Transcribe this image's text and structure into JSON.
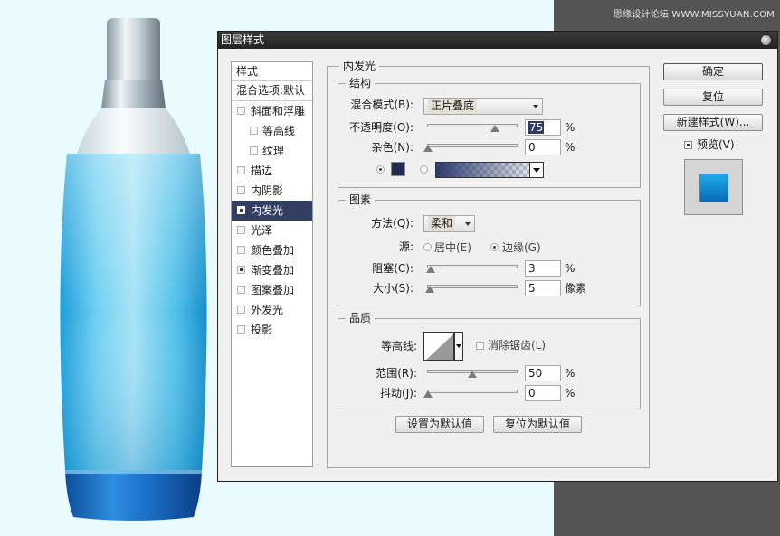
{
  "watermark": "思缘设计论坛 WWW.MISSYUAN.COM",
  "dialog": {
    "title": "图层样式"
  },
  "style_list": {
    "header": "样式",
    "blend_options": "混合选项:默认",
    "items": [
      {
        "label": "斜面和浮雕",
        "checked": false,
        "sub": false
      },
      {
        "label": "等高线",
        "checked": false,
        "sub": true
      },
      {
        "label": "纹理",
        "checked": false,
        "sub": true
      },
      {
        "label": "描边",
        "checked": false,
        "sub": false
      },
      {
        "label": "内阴影",
        "checked": false,
        "sub": false
      },
      {
        "label": "内发光",
        "checked": true,
        "sub": false,
        "selected": true
      },
      {
        "label": "光泽",
        "checked": false,
        "sub": false
      },
      {
        "label": "颜色叠加",
        "checked": false,
        "sub": false
      },
      {
        "label": "渐变叠加",
        "checked": true,
        "sub": false
      },
      {
        "label": "图案叠加",
        "checked": false,
        "sub": false
      },
      {
        "label": "外发光",
        "checked": false,
        "sub": false
      },
      {
        "label": "投影",
        "checked": false,
        "sub": false
      }
    ]
  },
  "inner_glow": {
    "title": "内发光",
    "structure": {
      "title": "结构",
      "blend_mode_label": "混合模式(B):",
      "blend_mode_value": "正片叠底",
      "opacity_label": "不透明度(O):",
      "opacity_value": "75",
      "opacity_unit": "%",
      "opacity_level": 0.75,
      "noise_label": "杂色(N):",
      "noise_value": "0",
      "noise_unit": "%",
      "noise_level": 0.0,
      "glow_color": "#1f2b54",
      "gradient_start_color": "#2a3a6e"
    },
    "elements": {
      "title": "图素",
      "method_label": "方法(Q):",
      "method_value": "柔和",
      "source_label": "源:",
      "source_center": "居中(E)",
      "source_edge": "边缘(G)",
      "choke_label": "阻塞(C):",
      "choke_value": "3",
      "choke_unit": "%",
      "choke_level": 0.03,
      "size_label": "大小(S):",
      "size_value": "5",
      "size_unit": "像素",
      "size_level": 0.02
    },
    "quality": {
      "title": "品质",
      "contour_label": "等高线:",
      "anti_alias_label": "消除锯齿(L)",
      "range_label": "范围(R):",
      "range_value": "50",
      "range_unit": "%",
      "range_level": 0.5,
      "jitter_label": "抖动(J):",
      "jitter_value": "0",
      "jitter_unit": "%",
      "jitter_level": 0.0
    },
    "set_default": "设置为默认值",
    "reset_default": "复位为默认值"
  },
  "actions": {
    "ok": "确定",
    "reset": "复位",
    "new_style": "新建样式(W)...",
    "preview": "预览(V)"
  }
}
